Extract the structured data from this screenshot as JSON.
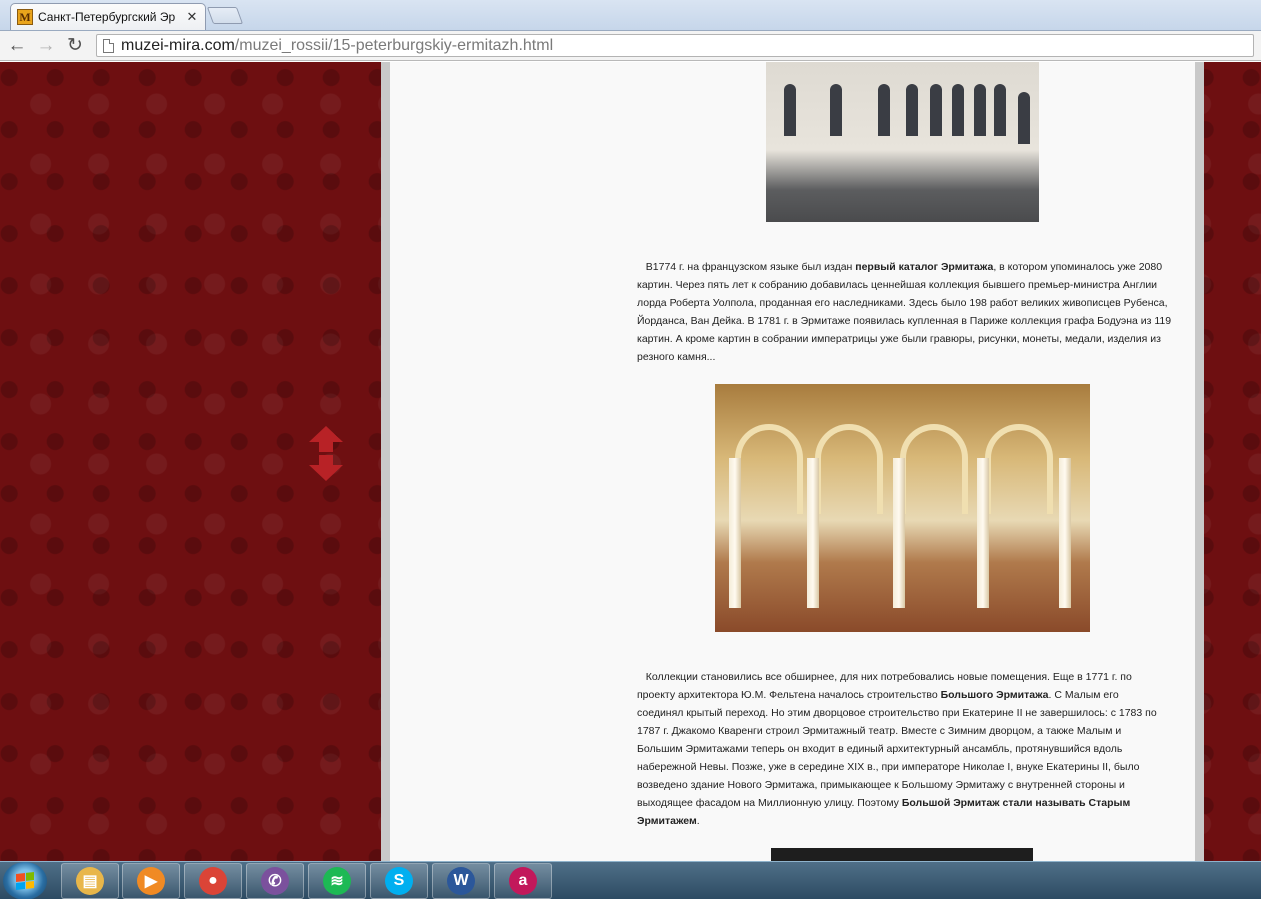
{
  "browser": {
    "tab_title": "Санкт-Петербургский Эр",
    "favicon_letter": "M",
    "tab_close_glyph": "✕",
    "url_domain": "muzei-mira.com",
    "url_path": "/muzei_rossii/15-peterburgskiy-ermitazh.html",
    "back_glyph": "←",
    "forward_glyph": "→",
    "reload_glyph": "↻"
  },
  "article": {
    "p1_lead": "В1774 г. на французском языке был издан ",
    "p1_bold": "первый каталог Эрмитажа",
    "p1_rest": ", в котором упоминалось уже 2080 картин. Через пять лет к собранию добавилась ценнейшая коллекция бывшего премьер-министра Англии лорда Роберта Уолпола, проданная его наследниками. Здесь было 198 работ великих живописцев Рубенса, Йорданса, Ван Дейка. В 1781 г. в Эрмитаже появилась купленная в Париже коллекция графа Бодуэна из 119 картин. А кроме картин в собрании императрицы уже были гравюры, рисунки, монеты, медали, изделия из резного камня...",
    "p2_lead": "Коллекции становились все обширнее, для них потребовались новые помещения. Еще в 1771 г. по проекту архитектора Ю.М. Фельтена началось строительство ",
    "p2_bold1": "Большого Эрмитажа",
    "p2_mid": ". С Малым его соединял крытый переход. Но этим дворцовое строительство при Екатерине II не завершилось: с 1783 по 1787 г. Джакомо Кваренги строил Эрмитажный театр. Вместе с Зимним дворцом, а также Малым и Большим Эрмитажами теперь он входит в единый архитектурный ансамбль, протянувшийся вдоль набережной Невы. Позже, уже в середине XIX в., при императоре Николае I, внуке Екатерины II, было возведено здание Нового Эрмитажа, примыкающее к Большому Эрмитажу с внутренней стороны и выходящее фасадом на Миллионную улицу. Поэтому ",
    "p2_bold2": "Большой Эрмитаж стали называть Старым Эрмитажем",
    "p2_end": "."
  },
  "taskbar": {
    "items": [
      {
        "name": "explorer",
        "glyph": "▤",
        "color": "#e8b64a"
      },
      {
        "name": "media-player",
        "glyph": "▶",
        "color": "#f08a24"
      },
      {
        "name": "chrome",
        "glyph": "●",
        "color": "#db4437"
      },
      {
        "name": "viber",
        "glyph": "✆",
        "color": "#7b519d"
      },
      {
        "name": "spotify",
        "glyph": "≋",
        "color": "#1db954"
      },
      {
        "name": "skype",
        "glyph": "S",
        "color": "#00aff0"
      },
      {
        "name": "word",
        "glyph": "W",
        "color": "#2b579a"
      },
      {
        "name": "app",
        "glyph": "a",
        "color": "#c2185b"
      }
    ]
  }
}
